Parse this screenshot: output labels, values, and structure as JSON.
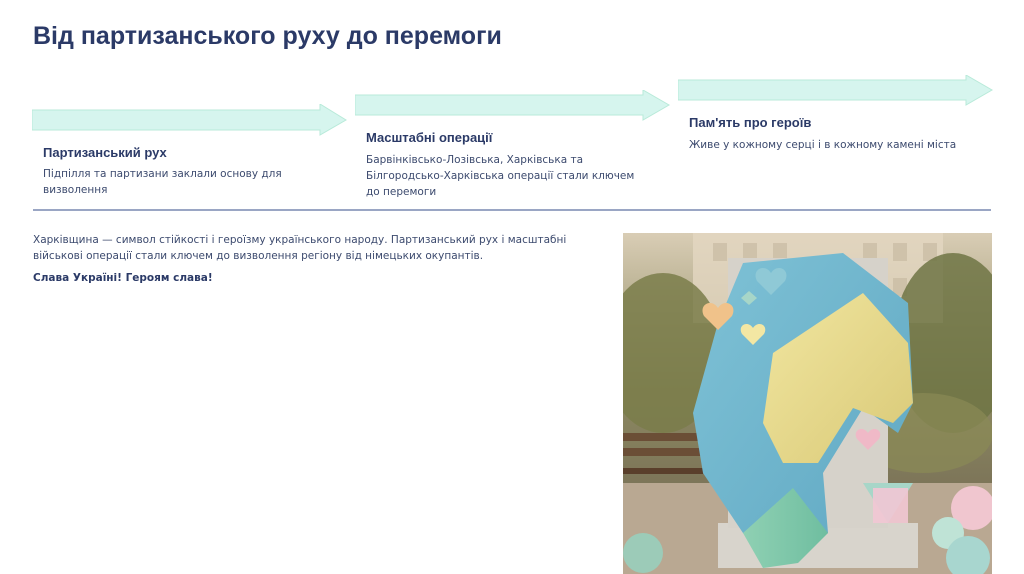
{
  "page": {
    "title": "Від партизанського руху до перемоги"
  },
  "timeline": {
    "steps": [
      {
        "title": "Партизанський рух",
        "description": "Підпілля та партизани заклали основу для визволення"
      },
      {
        "title": "Масштабні операції",
        "description": "Барвінківсько-Лозівська, Харківська та Білгородсько-Харківська операції стали ключем до перемоги"
      },
      {
        "title": "Пам'ять про героїв",
        "description": "Живе у кожному серці і в кожному камені міста"
      }
    ]
  },
  "content": {
    "paragraph": "Харківщина — символ стійкості і героїзму українського народу. Партизанський рух і масштабні військові операції стали ключем до визволення регіону від німецьких окупантів.",
    "slogan": "Слава Україні! Героям слава!"
  },
  "colors": {
    "title": "#2b3a67",
    "arrow_fill": "#d6f5ee",
    "arrow_stroke": "#b8ead9",
    "divider": "#9aa6c4"
  },
  "image": {
    "description_icon": "monument-with-ukrainian-flag-photo"
  }
}
